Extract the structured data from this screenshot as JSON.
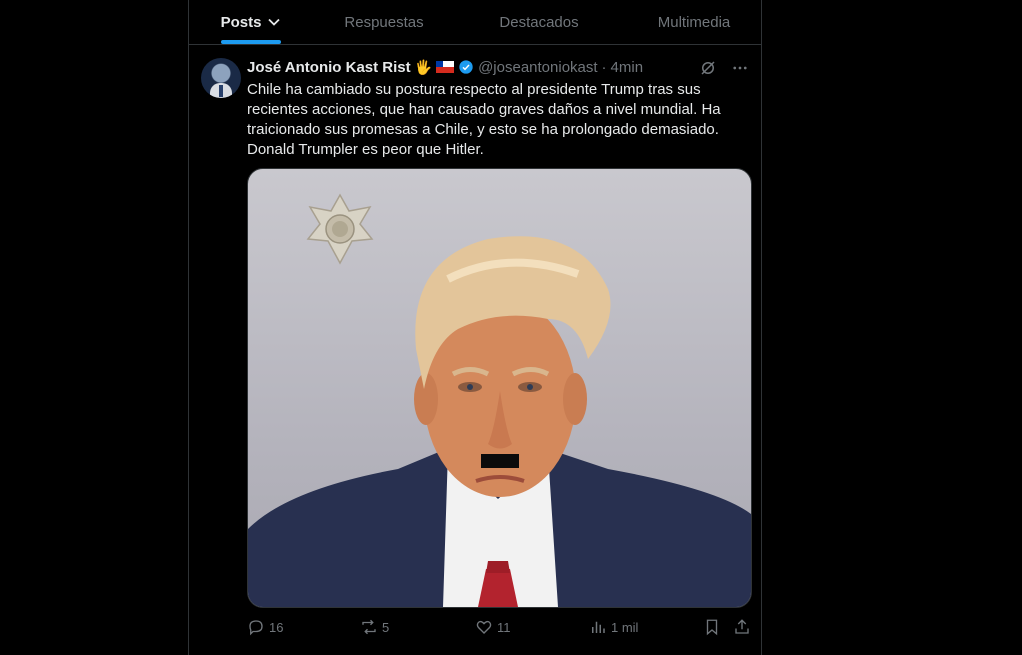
{
  "tabs": [
    {
      "label": "Posts",
      "active": true
    },
    {
      "label": "Respuestas",
      "active": false
    },
    {
      "label": "Destacados",
      "active": false
    },
    {
      "label": "Multimedia",
      "active": false
    }
  ],
  "post": {
    "author_name": "José Antonio Kast Rist",
    "author_emoji": "🖐",
    "handle": "@joseantoniokast",
    "separator": "·",
    "time": "4min",
    "text": "Chile ha cambiado su postura respecto al presidente Trump tras sus recientes acciones, que han causado graves daños a nivel mundial. Ha traicionado sus promesas a Chile, y esto se ha prolongado demasiado. Donald Trumpler es peor que Hitler.",
    "media": {
      "background_colors": [
        "#c9c8ce",
        "#a9a8b1"
      ],
      "suit_color": "#283050",
      "tie_color": "#b3232e",
      "hair_color": "#e3c59a",
      "skin_color": "#d4895c"
    },
    "stats": {
      "replies": "16",
      "reposts": "5",
      "likes": "11",
      "views": "1 mil"
    }
  },
  "colors": {
    "accent": "#1d9bf0",
    "background": "#000000",
    "text_primary": "#e7e9ea",
    "text_secondary": "#71767b",
    "border": "#2f3336"
  }
}
